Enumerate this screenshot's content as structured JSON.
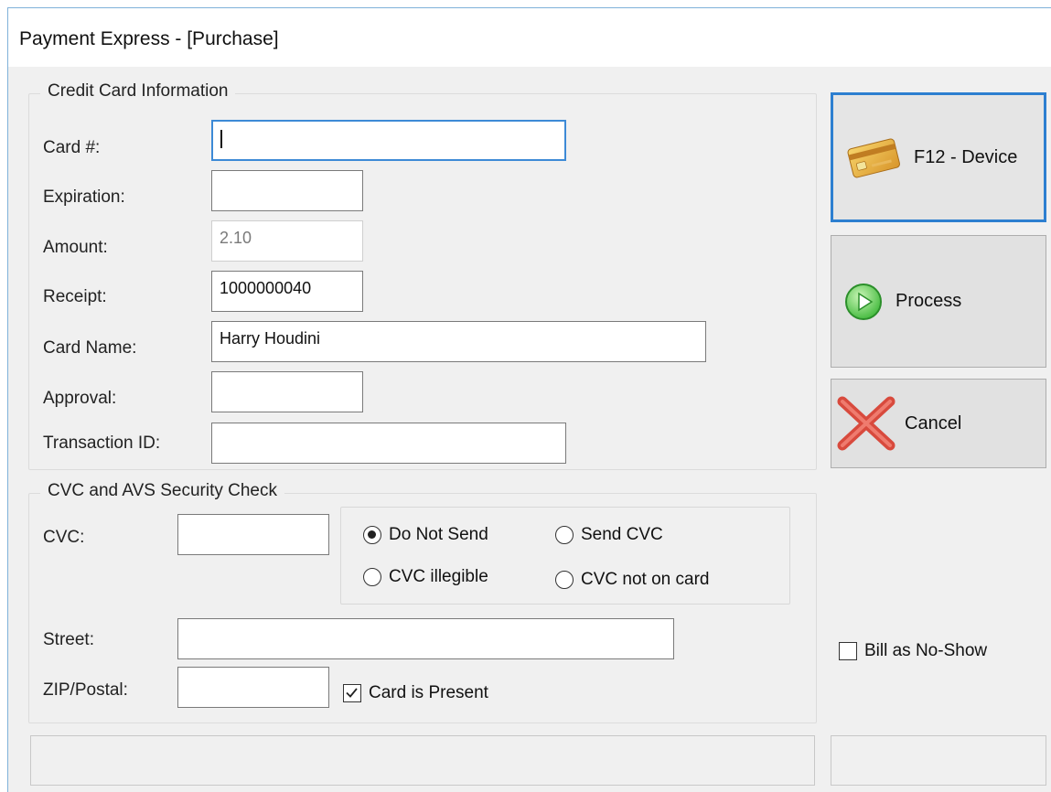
{
  "window": {
    "title": "Payment Express - [Purchase]"
  },
  "credit_card": {
    "group_title": "Credit Card Information",
    "labels": {
      "card": "Card #:",
      "expiration": "Expiration:",
      "amount": "Amount:",
      "receipt": "Receipt:",
      "card_name": "Card Name:",
      "approval": "Approval:",
      "transaction_id": "Transaction ID:"
    },
    "values": {
      "card": "",
      "expiration": "",
      "amount": "2.10",
      "receipt": "1000000040",
      "card_name": "Harry Houdini",
      "approval": "",
      "transaction_id": ""
    }
  },
  "security": {
    "group_title": "CVC and AVS Security Check",
    "labels": {
      "cvc": "CVC:",
      "street": "Street:",
      "zip": "ZIP/Postal:"
    },
    "values": {
      "cvc": "",
      "street": "",
      "zip": ""
    },
    "cvc_options": [
      {
        "label": "Do Not Send",
        "selected": true
      },
      {
        "label": "Send CVC",
        "selected": false
      },
      {
        "label": "CVC illegible",
        "selected": false
      },
      {
        "label": "CVC not on card",
        "selected": false
      }
    ],
    "card_present": {
      "label": "Card is Present",
      "checked": true
    }
  },
  "buttons": {
    "device": "F12 - Device",
    "process": "Process",
    "cancel": "Cancel"
  },
  "bill_no_show": {
    "label": "Bill as No-Show",
    "checked": false
  },
  "colors": {
    "accent": "#2d7fd0",
    "window_bg": "#f0f0f0"
  }
}
